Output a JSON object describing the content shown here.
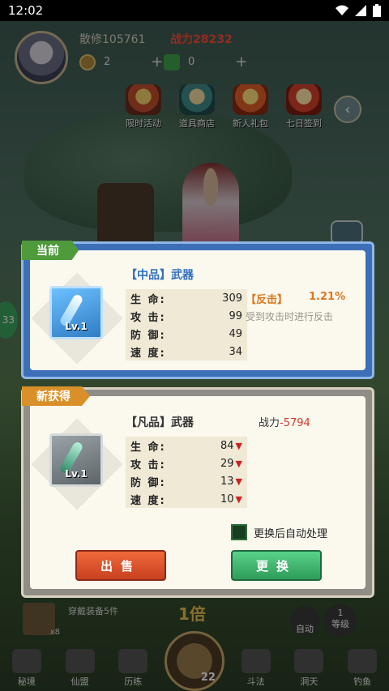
{
  "status_bar": {
    "time": "12:02"
  },
  "player": {
    "name": "散修105761",
    "power": "战力28232"
  },
  "resources": [
    {
      "icon": "coin-icon",
      "value": "2"
    },
    {
      "icon": "jade-icon",
      "value": "0"
    }
  ],
  "menu": [
    {
      "label": "限时活动",
      "icon": "event-icon"
    },
    {
      "label": "道具商店",
      "icon": "shop-icon"
    },
    {
      "label": "新人礼包",
      "icon": "gift-icon"
    },
    {
      "label": "七日签到",
      "icon": "checkin-icon"
    }
  ],
  "side_badge": "33",
  "current": {
    "tag": "当前",
    "title": "【中品】武器",
    "level": "Lv.1",
    "stats": [
      {
        "name": "生 命:",
        "value": "309"
      },
      {
        "name": "攻 击:",
        "value": "99"
      },
      {
        "name": "防 御:",
        "value": "49"
      },
      {
        "name": "速 度:",
        "value": "34"
      }
    ],
    "bonus_name": "【反击】",
    "bonus_value": "1.21%",
    "bonus_desc": "受到攻击时进行反击"
  },
  "new_item": {
    "tag": "新获得",
    "title": "【凡品】武器",
    "power_label": "战力",
    "power_value": "-5794",
    "level": "Lv.1",
    "stats": [
      {
        "name": "生 命:",
        "value": "84"
      },
      {
        "name": "攻 击:",
        "value": "29"
      },
      {
        "name": "防 御:",
        "value": "13"
      },
      {
        "name": "速 度:",
        "value": "10"
      }
    ],
    "auto_process_label": "更换后自动处理",
    "sell_label": "出售",
    "swap_label": "更换"
  },
  "bottom": {
    "equip_text": "穿戴装备5件",
    "axe_count": "x8",
    "multiplier": "1倍",
    "auto_label": "自动",
    "level_label": "等级",
    "level_value": "1"
  },
  "navbar": [
    {
      "label": "秘境"
    },
    {
      "label": "仙盟"
    },
    {
      "label": "历练"
    },
    {
      "label": "斗法"
    },
    {
      "label": "洞天"
    },
    {
      "label": "钓鱼"
    }
  ],
  "navbar_center_count": "22",
  "colors": {
    "current_frame": "#3d6fb8",
    "sell_button": "#e05530",
    "swap_button": "#3fbd72",
    "power_red": "#d23a2a"
  }
}
